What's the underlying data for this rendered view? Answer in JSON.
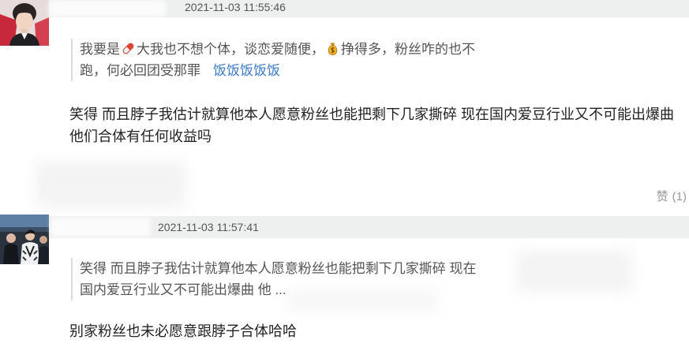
{
  "colors": {
    "header_bar": "#eef0ef",
    "quote_border": "#dcdcdc",
    "link": "#3d7bc4",
    "quote_text": "#555555",
    "body_text": "#222222",
    "like_text": "#999999"
  },
  "comments": [
    {
      "avatar_icon": "user-avatar",
      "timestamp": "2021-11-03 11:55:46",
      "quote": [
        [
          "我要是",
          {
            "icon": "pill-emoji"
          },
          "大我也不想个体，谈恋爱随便，",
          {
            "icon": "money-bag-emoji"
          },
          "挣得多，粉丝咋的也不"
        ],
        [
          "跑，何必回团受那罪",
          {
            "link": "饭饭饭饭饭"
          }
        ]
      ],
      "body": [
        "笑得 而且脖子我估计就算他本人愿意粉丝也能把剩下几家撕碎 现在国内爱豆行业又不可能出爆曲",
        "他们合体有任何收益吗"
      ],
      "like_label": "赞",
      "like_count": "(1)"
    },
    {
      "avatar_icon": "user-avatar",
      "timestamp": "2021-11-03 11:57:41",
      "quote": [
        [
          "笑得 而且脖子我估计就算他本人愿意粉丝也能把剩下几家撕碎 现在"
        ],
        [
          "国内爱豆行业又不可能出爆曲 他 ..."
        ]
      ],
      "body": [
        "别家粉丝也未必愿意跟脖子合体哈哈"
      ]
    }
  ]
}
